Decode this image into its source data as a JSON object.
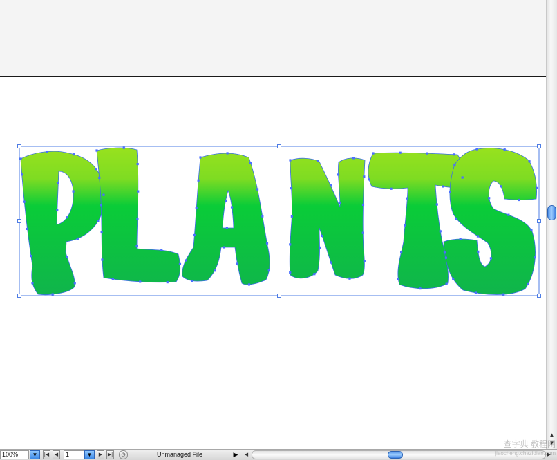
{
  "canvas": {
    "artwork_text": "PLANTS",
    "gradient_colors": {
      "top": "#9ae21e",
      "middle": "#0acc38",
      "bottom": "#10b44c"
    },
    "selection_color": "#3b6fe3",
    "artboard_color": "#ffffff",
    "pasteboard_color": "#f4f4f4"
  },
  "statusbar": {
    "zoom_value": "100%",
    "page_value": "1",
    "file_status": "Unmanaged File",
    "icons": {
      "zoom_dropdown": "chevron-down-icon",
      "first_page": "first-page-icon",
      "prev_page": "prev-page-icon",
      "page_dropdown": "chevron-down-icon",
      "next_page": "next-page-icon",
      "last_page": "last-page-icon",
      "status_menu": "status-menu-icon",
      "status_arrow": "triangle-right-icon"
    }
  },
  "scrollbars": {
    "vertical_position": 0.5,
    "horizontal_position": 0.5
  },
  "watermark": {
    "line1": "查字典 教程网",
    "line2": "jiaocheng.chazidian.com"
  }
}
